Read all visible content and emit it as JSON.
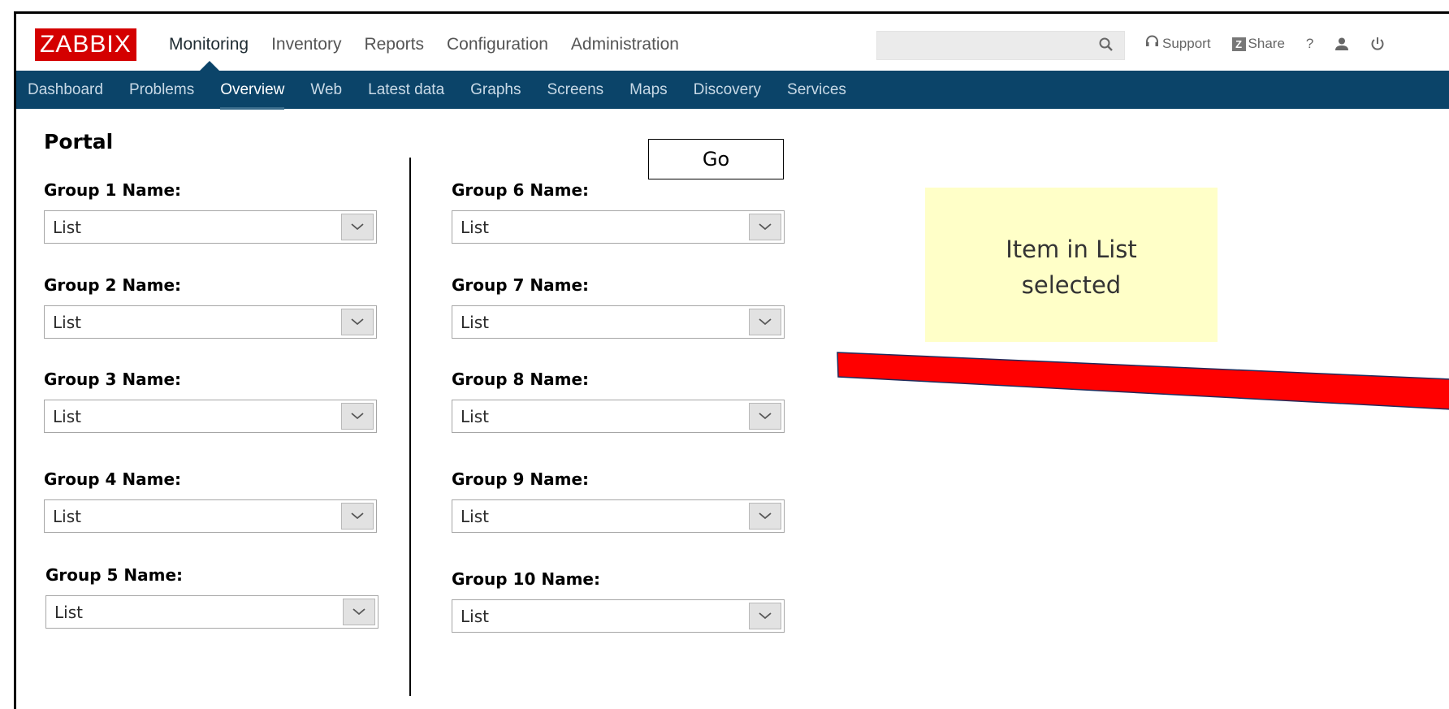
{
  "header": {
    "logo": "ZABBIX",
    "main_nav": [
      {
        "label": "Monitoring",
        "active": true
      },
      {
        "label": "Inventory"
      },
      {
        "label": "Reports"
      },
      {
        "label": "Configuration"
      },
      {
        "label": "Administration"
      }
    ],
    "search_placeholder": "",
    "support_label": "Support",
    "share_label": "Share",
    "help_label": "?"
  },
  "sub_nav": [
    {
      "label": "Dashboard"
    },
    {
      "label": "Problems"
    },
    {
      "label": "Overview",
      "active": true
    },
    {
      "label": "Web"
    },
    {
      "label": "Latest data"
    },
    {
      "label": "Graphs"
    },
    {
      "label": "Screens"
    },
    {
      "label": "Maps"
    },
    {
      "label": "Discovery"
    },
    {
      "label": "Services"
    }
  ],
  "page": {
    "title": "Portal",
    "go_label": "Go",
    "groups": [
      {
        "label": "Group 1 Name:",
        "value": "List"
      },
      {
        "label": "Group 2 Name:",
        "value": "List"
      },
      {
        "label": "Group 3 Name:",
        "value": "List"
      },
      {
        "label": "Group 4 Name:",
        "value": "List"
      },
      {
        "label": "Group 5 Name:",
        "value": "List"
      },
      {
        "label": "Group 6 Name:",
        "value": "List"
      },
      {
        "label": "Group 7 Name:",
        "value": "List"
      },
      {
        "label": "Group 8 Name:",
        "value": "List"
      },
      {
        "label": "Group 9 Name:",
        "value": "List"
      },
      {
        "label": "Group 10 Name:",
        "value": "List"
      }
    ],
    "note_line1": "Item in List",
    "note_line2": "selected"
  },
  "colors": {
    "logo_bg": "#d40000",
    "subnav_bg": "#0b4469",
    "note_bg": "#ffffc8",
    "arrow": "#ff0000"
  }
}
